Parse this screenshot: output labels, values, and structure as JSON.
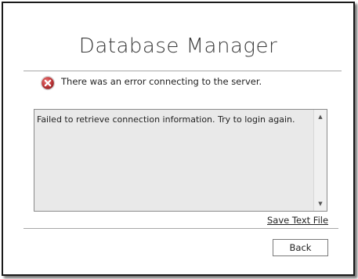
{
  "dialog": {
    "title": "Database Manager",
    "error_message": "There was an error connecting to the server.",
    "error_icon": "error-icon",
    "details_text": "Failed to retrieve connection information. Try to login again.",
    "save_link_label": "Save Text File",
    "back_label": "Back"
  },
  "colors": {
    "error_red": "#c0393b",
    "textbox_bg": "#e9e9e9"
  }
}
